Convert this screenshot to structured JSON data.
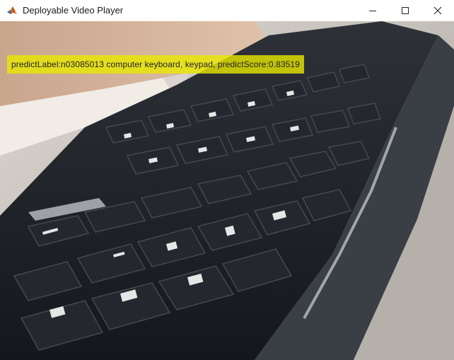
{
  "window": {
    "title": "Deployable Video Player",
    "app_icon": "matlab-logo-icon",
    "controls": [
      "minimize-icon",
      "maximize-icon",
      "close-icon"
    ]
  },
  "video": {
    "content": "camera frame of a black computer keyboard",
    "overlay_text": "predictLabel:n03085013 computer keyboard, keypad, predictScore:0.83519",
    "overlay_color": "#e8e800"
  }
}
